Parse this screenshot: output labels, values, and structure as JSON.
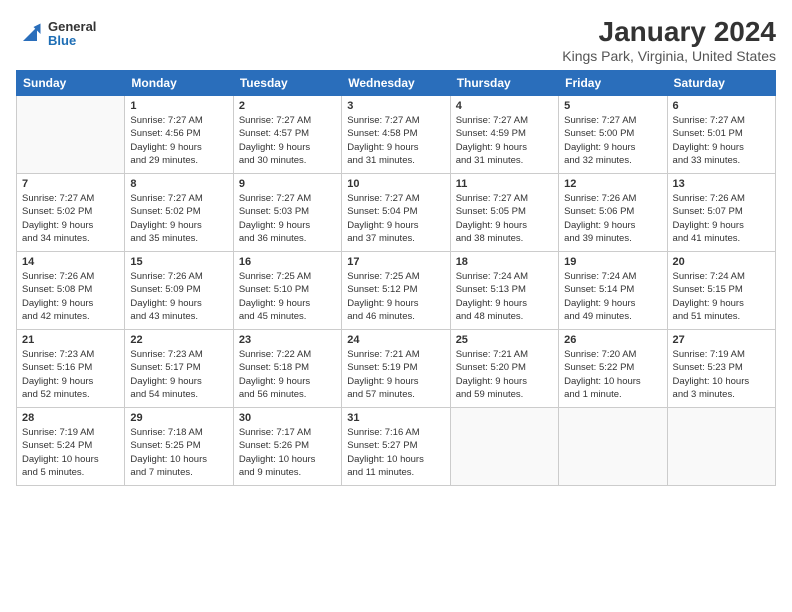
{
  "header": {
    "logo_general": "General",
    "logo_blue": "Blue",
    "title": "January 2024",
    "subtitle": "Kings Park, Virginia, United States"
  },
  "weekdays": [
    "Sunday",
    "Monday",
    "Tuesday",
    "Wednesday",
    "Thursday",
    "Friday",
    "Saturday"
  ],
  "weeks": [
    [
      {
        "day": "",
        "info": ""
      },
      {
        "day": "1",
        "info": "Sunrise: 7:27 AM\nSunset: 4:56 PM\nDaylight: 9 hours\nand 29 minutes."
      },
      {
        "day": "2",
        "info": "Sunrise: 7:27 AM\nSunset: 4:57 PM\nDaylight: 9 hours\nand 30 minutes."
      },
      {
        "day": "3",
        "info": "Sunrise: 7:27 AM\nSunset: 4:58 PM\nDaylight: 9 hours\nand 31 minutes."
      },
      {
        "day": "4",
        "info": "Sunrise: 7:27 AM\nSunset: 4:59 PM\nDaylight: 9 hours\nand 31 minutes."
      },
      {
        "day": "5",
        "info": "Sunrise: 7:27 AM\nSunset: 5:00 PM\nDaylight: 9 hours\nand 32 minutes."
      },
      {
        "day": "6",
        "info": "Sunrise: 7:27 AM\nSunset: 5:01 PM\nDaylight: 9 hours\nand 33 minutes."
      }
    ],
    [
      {
        "day": "7",
        "info": "Sunrise: 7:27 AM\nSunset: 5:02 PM\nDaylight: 9 hours\nand 34 minutes."
      },
      {
        "day": "8",
        "info": "Sunrise: 7:27 AM\nSunset: 5:02 PM\nDaylight: 9 hours\nand 35 minutes."
      },
      {
        "day": "9",
        "info": "Sunrise: 7:27 AM\nSunset: 5:03 PM\nDaylight: 9 hours\nand 36 minutes."
      },
      {
        "day": "10",
        "info": "Sunrise: 7:27 AM\nSunset: 5:04 PM\nDaylight: 9 hours\nand 37 minutes."
      },
      {
        "day": "11",
        "info": "Sunrise: 7:27 AM\nSunset: 5:05 PM\nDaylight: 9 hours\nand 38 minutes."
      },
      {
        "day": "12",
        "info": "Sunrise: 7:26 AM\nSunset: 5:06 PM\nDaylight: 9 hours\nand 39 minutes."
      },
      {
        "day": "13",
        "info": "Sunrise: 7:26 AM\nSunset: 5:07 PM\nDaylight: 9 hours\nand 41 minutes."
      }
    ],
    [
      {
        "day": "14",
        "info": "Sunrise: 7:26 AM\nSunset: 5:08 PM\nDaylight: 9 hours\nand 42 minutes."
      },
      {
        "day": "15",
        "info": "Sunrise: 7:26 AM\nSunset: 5:09 PM\nDaylight: 9 hours\nand 43 minutes."
      },
      {
        "day": "16",
        "info": "Sunrise: 7:25 AM\nSunset: 5:10 PM\nDaylight: 9 hours\nand 45 minutes."
      },
      {
        "day": "17",
        "info": "Sunrise: 7:25 AM\nSunset: 5:12 PM\nDaylight: 9 hours\nand 46 minutes."
      },
      {
        "day": "18",
        "info": "Sunrise: 7:24 AM\nSunset: 5:13 PM\nDaylight: 9 hours\nand 48 minutes."
      },
      {
        "day": "19",
        "info": "Sunrise: 7:24 AM\nSunset: 5:14 PM\nDaylight: 9 hours\nand 49 minutes."
      },
      {
        "day": "20",
        "info": "Sunrise: 7:24 AM\nSunset: 5:15 PM\nDaylight: 9 hours\nand 51 minutes."
      }
    ],
    [
      {
        "day": "21",
        "info": "Sunrise: 7:23 AM\nSunset: 5:16 PM\nDaylight: 9 hours\nand 52 minutes."
      },
      {
        "day": "22",
        "info": "Sunrise: 7:23 AM\nSunset: 5:17 PM\nDaylight: 9 hours\nand 54 minutes."
      },
      {
        "day": "23",
        "info": "Sunrise: 7:22 AM\nSunset: 5:18 PM\nDaylight: 9 hours\nand 56 minutes."
      },
      {
        "day": "24",
        "info": "Sunrise: 7:21 AM\nSunset: 5:19 PM\nDaylight: 9 hours\nand 57 minutes."
      },
      {
        "day": "25",
        "info": "Sunrise: 7:21 AM\nSunset: 5:20 PM\nDaylight: 9 hours\nand 59 minutes."
      },
      {
        "day": "26",
        "info": "Sunrise: 7:20 AM\nSunset: 5:22 PM\nDaylight: 10 hours\nand 1 minute."
      },
      {
        "day": "27",
        "info": "Sunrise: 7:19 AM\nSunset: 5:23 PM\nDaylight: 10 hours\nand 3 minutes."
      }
    ],
    [
      {
        "day": "28",
        "info": "Sunrise: 7:19 AM\nSunset: 5:24 PM\nDaylight: 10 hours\nand 5 minutes."
      },
      {
        "day": "29",
        "info": "Sunrise: 7:18 AM\nSunset: 5:25 PM\nDaylight: 10 hours\nand 7 minutes."
      },
      {
        "day": "30",
        "info": "Sunrise: 7:17 AM\nSunset: 5:26 PM\nDaylight: 10 hours\nand 9 minutes."
      },
      {
        "day": "31",
        "info": "Sunrise: 7:16 AM\nSunset: 5:27 PM\nDaylight: 10 hours\nand 11 minutes."
      },
      {
        "day": "",
        "info": ""
      },
      {
        "day": "",
        "info": ""
      },
      {
        "day": "",
        "info": ""
      }
    ]
  ]
}
